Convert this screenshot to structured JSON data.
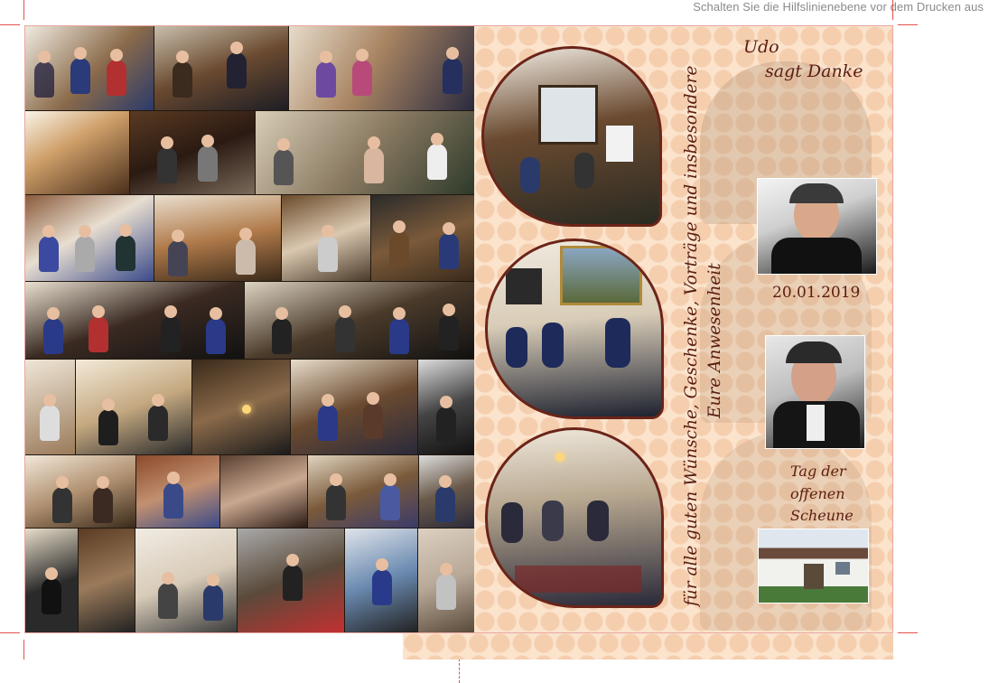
{
  "header_note": "Schalten Sie die Hilfslinienebene vor dem Drucken aus",
  "thanks": {
    "name": "Udo",
    "line": "sagt Danke"
  },
  "dedication": {
    "line1": "für alle guten Wünsche, Geschenke, Vorträge und insbesondere",
    "line2": "Eure Anwesenheit"
  },
  "date": "20.01.2019",
  "event": {
    "line1": "Tag der",
    "line2": "offenen",
    "line3": "Scheune"
  },
  "colors": {
    "accent": "#5a1e12",
    "panel": "#fbe3cc",
    "crop_marks": "#e4504a"
  }
}
